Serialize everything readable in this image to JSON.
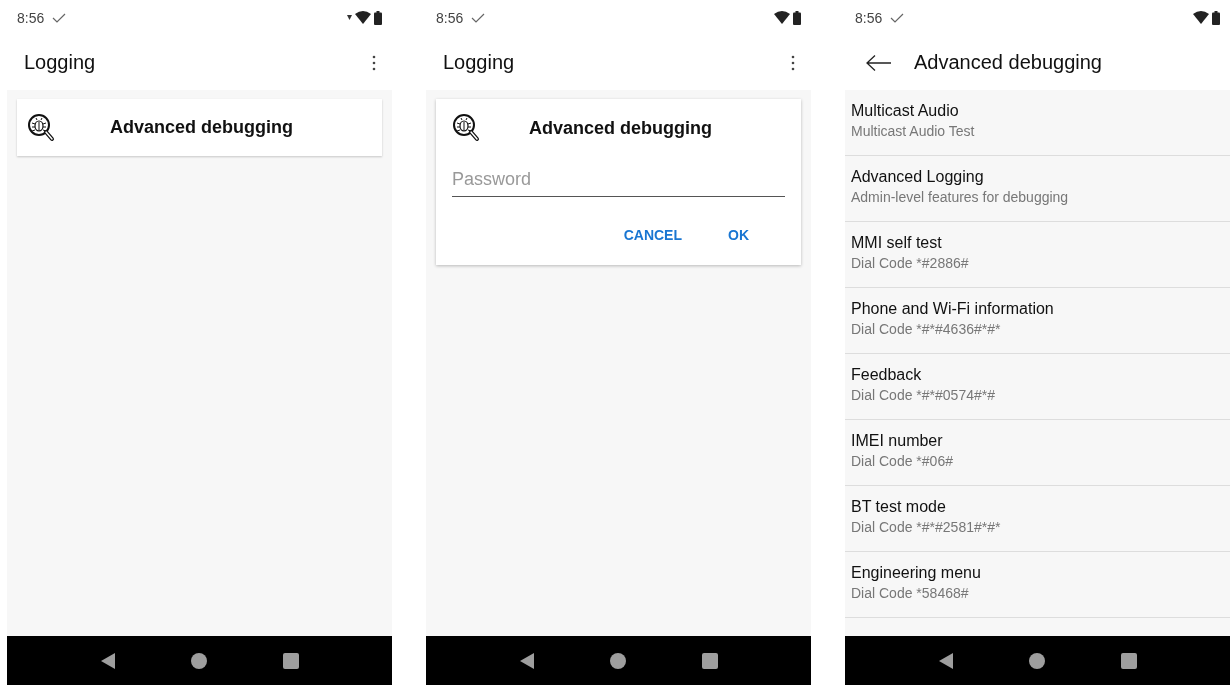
{
  "screens": [
    {
      "kind": "card",
      "status": {
        "time": "8:56",
        "data_activity": true
      },
      "app_bar": {
        "title": "Logging",
        "back": false,
        "menu": true
      },
      "card": {
        "title": "Advanced debugging"
      }
    },
    {
      "kind": "dialog",
      "status": {
        "time": "8:56",
        "data_activity": false
      },
      "app_bar": {
        "title": "Logging",
        "back": false,
        "menu": true
      },
      "dialog": {
        "title": "Advanced debugging",
        "password": {
          "placeholder": "Password"
        },
        "buttons": [
          "CANCEL",
          "OK"
        ]
      }
    },
    {
      "kind": "list",
      "status": {
        "time": "8:56",
        "data_activity": false
      },
      "app_bar": {
        "title": "Advanced debugging",
        "back": true,
        "menu": false
      },
      "items": [
        {
          "title": "Multicast Audio",
          "subtitle": "Multicast Audio Test"
        },
        {
          "title": "Advanced Logging",
          "subtitle": "Admin-level features for debugging"
        },
        {
          "title": "MMI self test",
          "subtitle": "Dial Code *#2886#"
        },
        {
          "title": "Phone and Wi-Fi information",
          "subtitle": "Dial Code *#*#4636#*#*"
        },
        {
          "title": "Feedback",
          "subtitle": "Dial Code *#*#0574#*#"
        },
        {
          "title": "IMEI number",
          "subtitle": "Dial Code *#06#"
        },
        {
          "title": "BT test mode",
          "subtitle": "Dial Code *#*#2581#*#*"
        },
        {
          "title": "Engineering menu",
          "subtitle": "Dial Code *58468#"
        }
      ]
    }
  ]
}
